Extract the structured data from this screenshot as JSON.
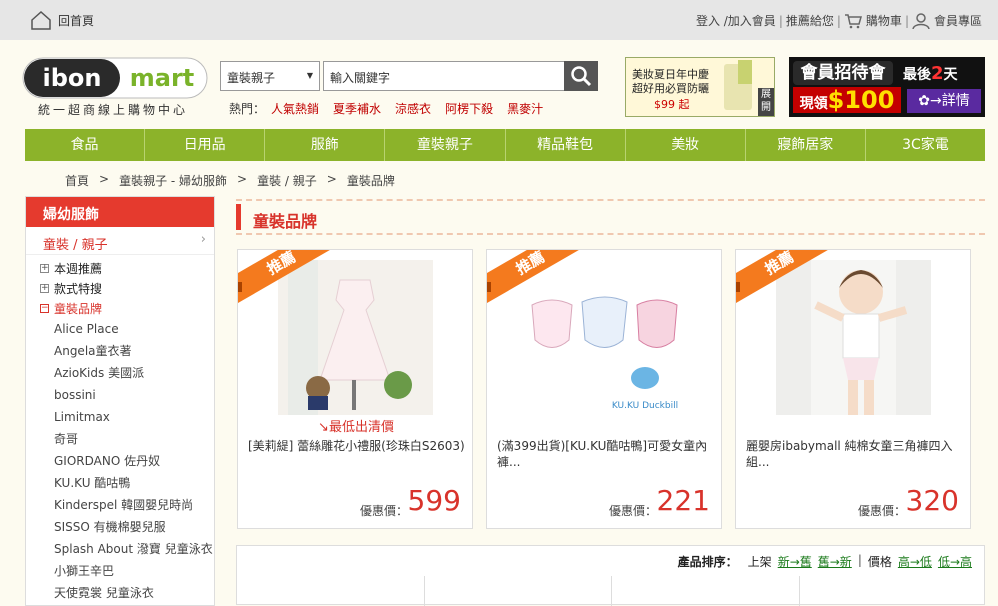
{
  "topbar": {
    "home_label": "回首頁",
    "links": [
      "登入 /加入會員",
      "推薦給您",
      "購物車",
      "會員專區"
    ]
  },
  "header": {
    "logo_text_1": "ibon",
    "logo_text_2": "mart",
    "logo_sub": "統一超商線上購物中心",
    "category_value": "童裝親子",
    "search_value": "輸入關鍵字",
    "hot_label": "熱門：",
    "hot_items": [
      "人氣熱銷",
      "夏季補水",
      "涼感衣",
      "阿楞下殺",
      "黑麥汁"
    ],
    "banner1_line1": "美妝夏日年中慶",
    "banner1_line2": "超好用必買防曬",
    "banner1_price": "$99 起",
    "banner1_expand": "展開",
    "banner2_title": "會員招待會",
    "banner2_last": "最後",
    "banner2_days": "2",
    "banner2_days_unit": "天",
    "banner2_cash_pre": "現領",
    "banner2_cash": "$100",
    "banner2_detail": "詳情"
  },
  "nav": [
    "食品",
    "日用品",
    "服飾",
    "童裝親子",
    "精品鞋包",
    "美妝",
    "寢飾居家",
    "3C家電"
  ],
  "breadcrumb": [
    "首頁",
    ">",
    "童裝親子 - 婦幼服飾",
    ">",
    "童裝 / 親子",
    ">",
    "童裝品牌"
  ],
  "sidebar": {
    "head": "婦幼服飾",
    "sub": "童裝 / 親子",
    "groups": [
      {
        "label": "本週推薦",
        "box": "+"
      },
      {
        "label": "款式特搜",
        "box": "+"
      },
      {
        "label": "童裝品牌",
        "box": "−"
      }
    ],
    "brands": [
      "Alice Place",
      "Angela童衣著",
      "AzioKids 美國派",
      "bossini",
      "Limitmax",
      "奇哥",
      "GIORDANO 佐丹奴",
      "KU.KU 酷咕鴨",
      "Kinderspel 韓國嬰兒時尚",
      "SISSO 有機棉嬰兒服",
      "Splash About 潑寶 兒童泳衣",
      "小獅王辛巴",
      "天使霓裳 兒童泳衣"
    ]
  },
  "section_title": "童裝品牌",
  "products": [
    {
      "ribbon": "推薦",
      "promo": "↘最低出清價",
      "name": "[美莉緹] 蕾絲雕花小禮服(珍珠白S2603)",
      "price_label": "優惠價：",
      "price": "599"
    },
    {
      "ribbon": "推薦",
      "promo": "",
      "name": "(滿399出貨)[KU.KU酷咕鴨]可愛女童內褲...",
      "price_label": "優惠價：",
      "price": "221"
    },
    {
      "ribbon": "推薦",
      "promo": "",
      "name": "麗嬰房ibabymall 純棉女童三角褲四入組...",
      "price_label": "優惠價：",
      "price": "320"
    }
  ],
  "sort": {
    "title": "產品排序：",
    "shelf_label": "上架",
    "new_to_old": "新→舊",
    "old_to_new": "舊→新",
    "price_label": "價格",
    "high_to_low": "高→低",
    "low_to_high": "低→高"
  },
  "kuku_logo_text": "KU.KU Duckbill"
}
